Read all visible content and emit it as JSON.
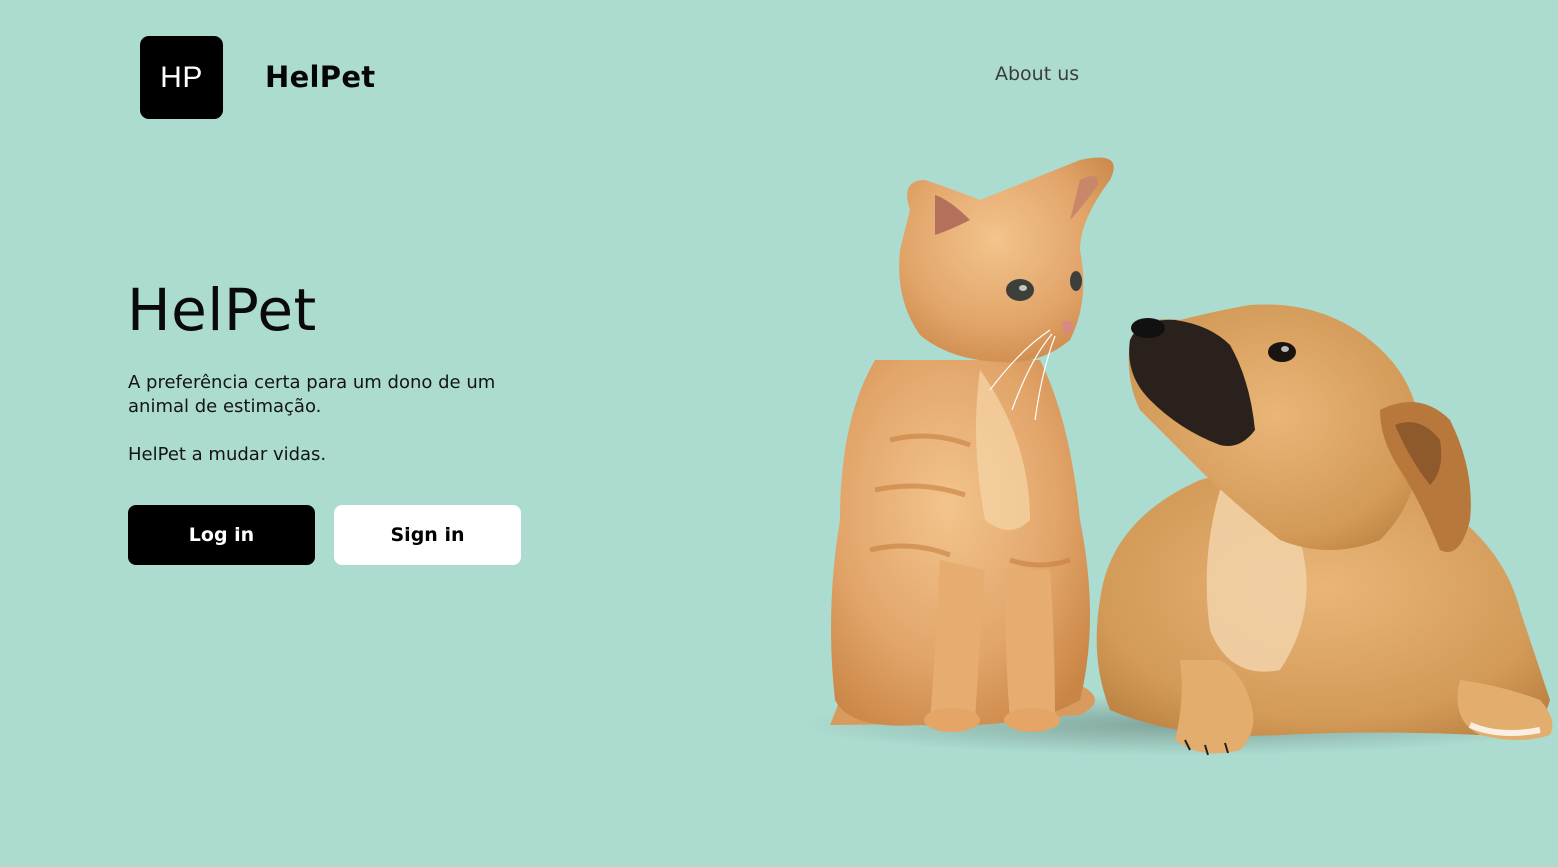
{
  "header": {
    "logo_initials": "HP",
    "brand_name": "HelPet",
    "nav_about": "About us"
  },
  "hero": {
    "title": "HelPet",
    "description": "A preferência certa para um dono de um animal de estimação.",
    "tagline": "HelPet a mudar vidas.",
    "login_label": "Log in",
    "signin_label": "Sign in",
    "image_subject": "kitten-and-puppy"
  },
  "colors": {
    "background": "#acdbd0",
    "primary_button": "#000000",
    "secondary_button": "#ffffff"
  }
}
